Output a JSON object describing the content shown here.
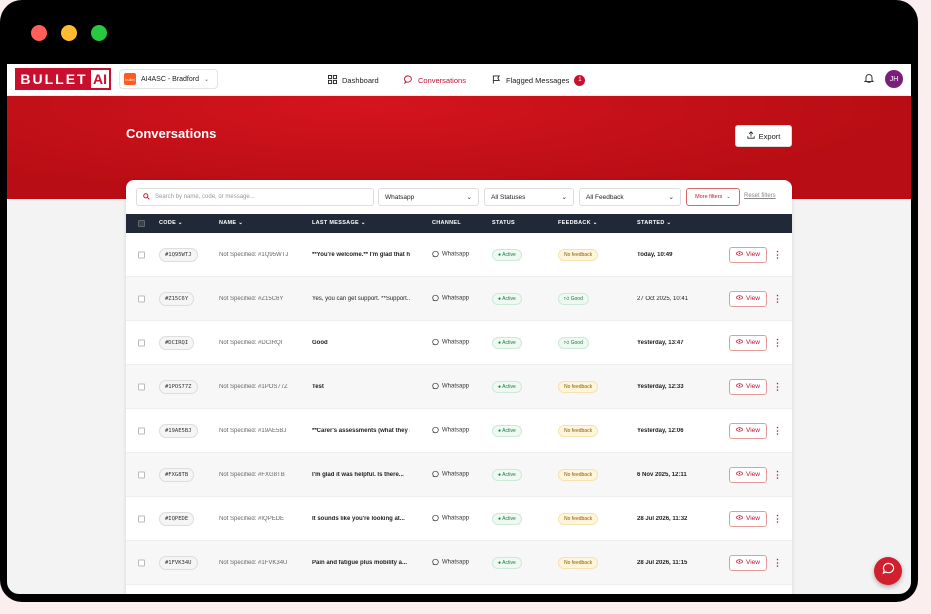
{
  "window": {
    "dots": [
      "#ff5f57",
      "#febc2e",
      "#28c840"
    ]
  },
  "brand": {
    "name": "BULLET",
    "suffix": "AI"
  },
  "org": {
    "badge": "bullet",
    "label": "AI4ASC - Bradford"
  },
  "nav": [
    {
      "label": "Dashboard",
      "icon": "grid-icon"
    },
    {
      "label": "Conversations",
      "icon": "chat-icon",
      "active": true
    },
    {
      "label": "Flagged Messages",
      "icon": "flag-icon",
      "count": "1"
    }
  ],
  "user": {
    "initials": "JH"
  },
  "page": {
    "title": "Conversations",
    "export_label": "Export"
  },
  "filters": {
    "search_placeholder": "Search by name, code, or message...",
    "channel": "Whatsapp",
    "status": "All Statuses",
    "feedback": "All Feedback",
    "more": "More filters",
    "reset": "Reset filters"
  },
  "columns": {
    "code": "CODE",
    "name": "NAME",
    "last_message": "LAST MESSAGE",
    "channel": "CHANNEL",
    "status": "STATUS",
    "feedback": "FEEDBACK",
    "started": "STARTED"
  },
  "rows": [
    {
      "code": "#1Q95WTJ",
      "name": "Not Specified: #1Q95WTJ",
      "msg": "**You're welcome.** I'm glad that helped",
      "channel": "Whatsapp",
      "status": "Active",
      "feedback": "No feedback",
      "fb_type": "none",
      "started": "Today, 10:49",
      "bold": true
    },
    {
      "code": "#Z15C6Y",
      "name": "Not Specified: #Z15C6Y",
      "msg": "Yes, you can get support. **Support...",
      "channel": "Whatsapp",
      "status": "Active",
      "feedback": "Good",
      "fb_type": "good",
      "started": "27 Oct 2025, 10:41",
      "bold": false
    },
    {
      "code": "#DCIRQI",
      "name": "Not Specified: #DCIRQI",
      "msg": "Good",
      "channel": "Whatsapp",
      "status": "Active",
      "feedback": "Good",
      "fb_type": "good",
      "started": "Yesterday, 13:47",
      "bold": true
    },
    {
      "code": "#1POS77Z",
      "name": "Not Specified: #1POS77Z",
      "msg": "Test",
      "channel": "Whatsapp",
      "status": "Active",
      "feedback": "No feedback",
      "fb_type": "none",
      "started": "Yesterday, 12:33",
      "bold": true
    },
    {
      "code": "#19AE5BJ",
      "name": "Not Specified: #19AE5BJ",
      "msg": "**Carer's assessments (what they are)**",
      "channel": "Whatsapp",
      "status": "Active",
      "feedback": "No feedback",
      "fb_type": "none",
      "started": "Yesterday, 12:06",
      "bold": true
    },
    {
      "code": "#FXG8TB",
      "name": "Not Specified: #FXG8TB",
      "msg": "I'm glad it was helpful. Is there...",
      "channel": "Whatsapp",
      "status": "Active",
      "feedback": "No feedback",
      "fb_type": "none",
      "started": "6 Nov 2025, 12:11",
      "bold": true
    },
    {
      "code": "#IQPEDE",
      "name": "Not Specified: #IQPEDE",
      "msg": "It sounds like you're looking at...",
      "channel": "Whatsapp",
      "status": "Active",
      "feedback": "No feedback",
      "fb_type": "none",
      "started": "28 Jul 2026, 11:32",
      "bold": true
    },
    {
      "code": "#1FVK34U",
      "name": "Not Specified: #1FVK34U",
      "msg": "Pain and fatigue plus mobility a...",
      "channel": "Whatsapp",
      "status": "Active",
      "feedback": "No feedback",
      "fb_type": "none",
      "started": "28 Jul 2026, 11:15",
      "bold": true
    }
  ],
  "row_action": "View"
}
